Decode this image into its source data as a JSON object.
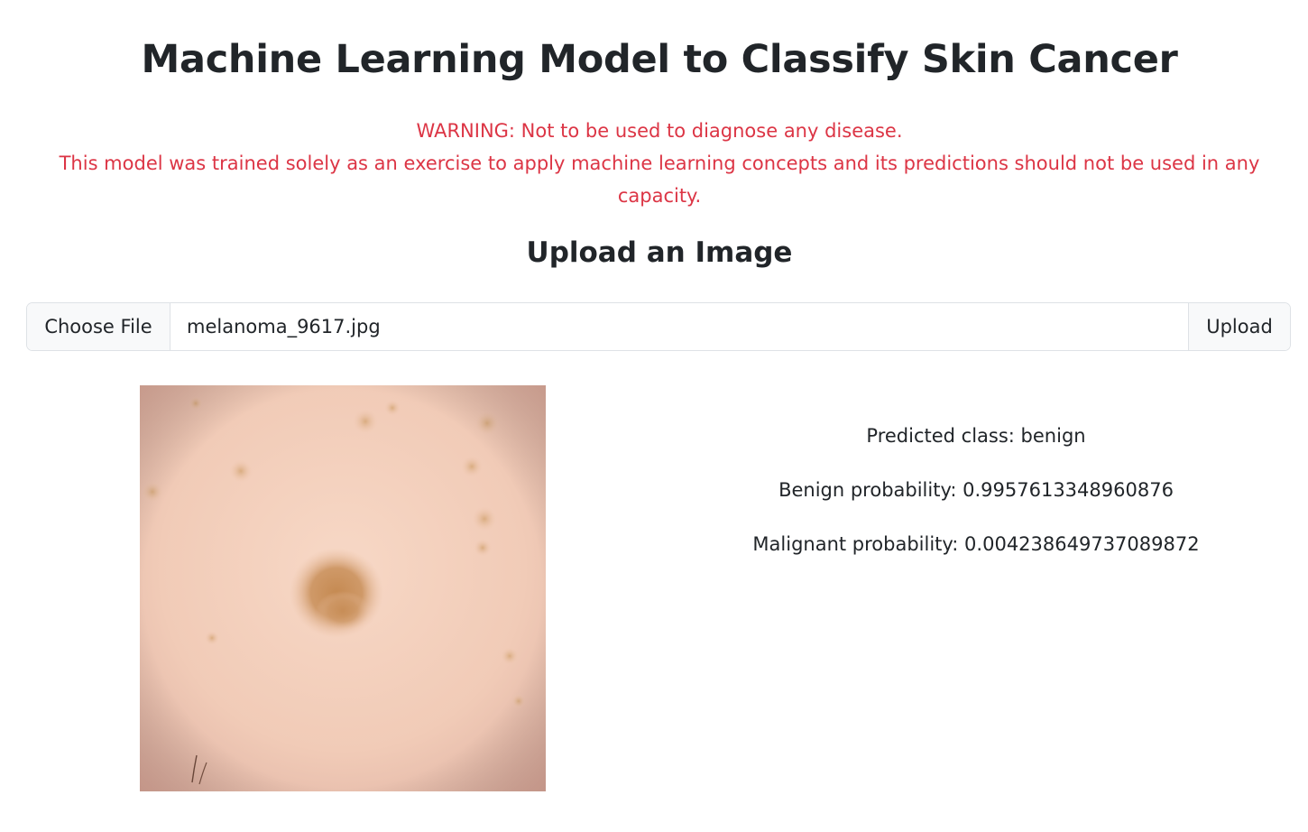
{
  "page": {
    "title": "Machine Learning Model to Classify Skin Cancer"
  },
  "warning": {
    "line1": "WARNING: Not to be used to diagnose any disease.",
    "line2": "This model was trained solely as an exercise to apply machine learning concepts and its predictions should not be used in any capacity."
  },
  "upload": {
    "heading": "Upload an Image",
    "choose_label": "Choose File",
    "file_name": "melanoma_9617.jpg",
    "submit_label": "Upload"
  },
  "results": {
    "predicted_class": "Predicted class: benign",
    "benign_probability": "Benign probability: 0.9957613348960876",
    "malignant_probability": "Malignant probability: 0.004238649737089872"
  },
  "colors": {
    "warning_text": "#dc3545",
    "skin_base": "#efc4ae",
    "lesion": "#c8905a"
  }
}
